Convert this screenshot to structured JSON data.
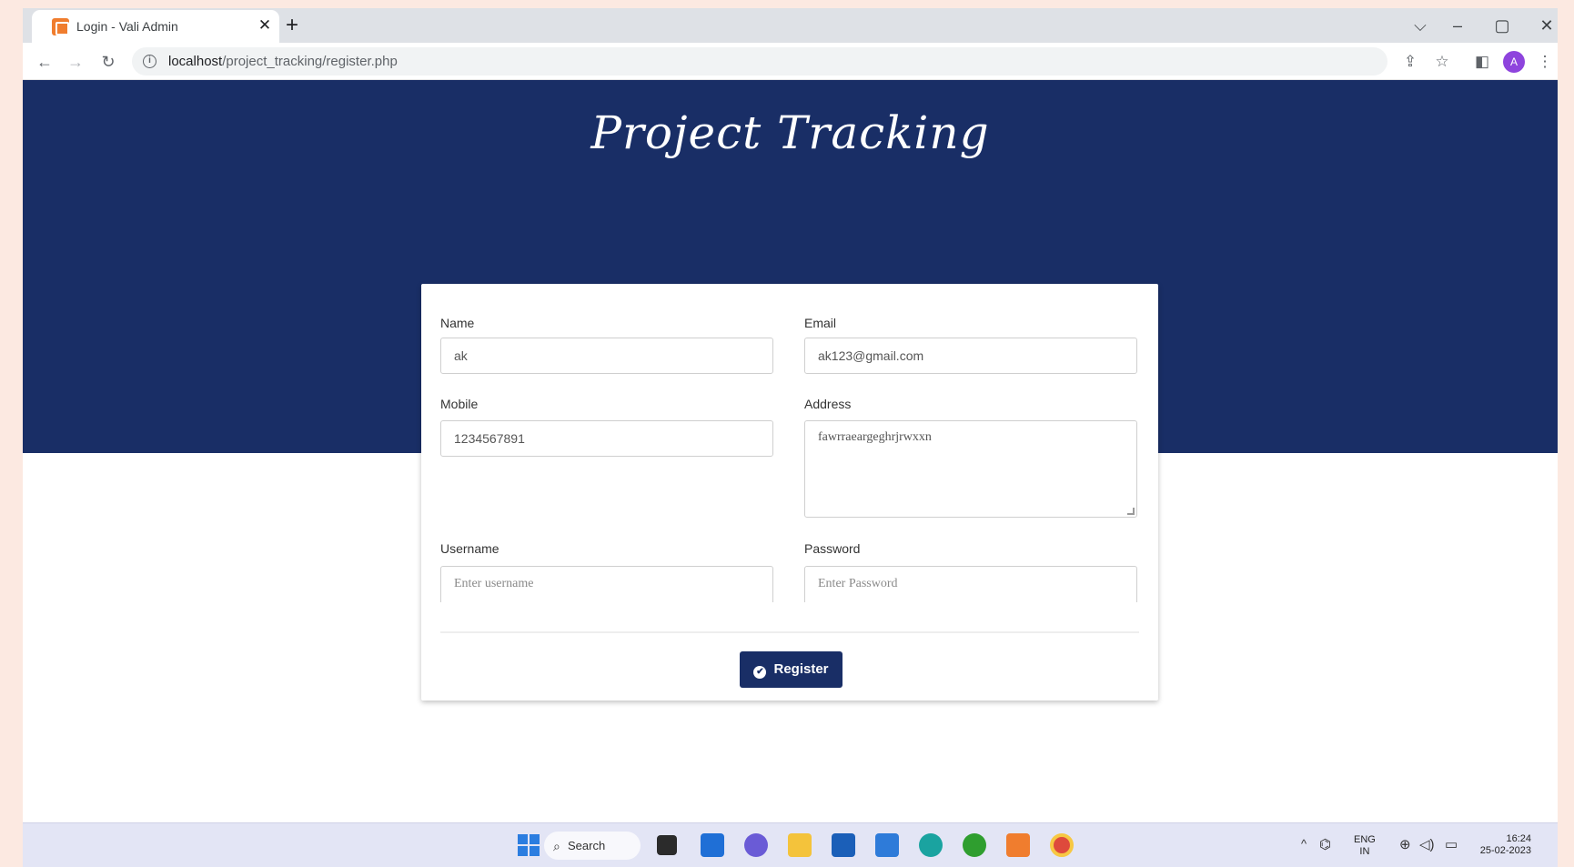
{
  "browser": {
    "tab_title": "Login - Vali Admin",
    "url_host": "localhost",
    "url_path": "/project_tracking/register.php",
    "controls": {
      "tab_list": "⌵",
      "minimize": "–",
      "maximize": "▢",
      "close": "✕",
      "tab_close": "✕",
      "new_tab": "+",
      "back": "←",
      "forward": "→",
      "reload": "↻",
      "info": "i",
      "share": "⇪",
      "bookmark": "☆",
      "sidepanel": "◧",
      "menu": "⋮"
    },
    "avatar_letter": "A"
  },
  "page": {
    "title": "Project Tracking",
    "form": {
      "name_label": "Name",
      "name_value": "ak",
      "email_label": "Email",
      "email_value": "ak123@gmail.com",
      "mobile_label": "Mobile",
      "mobile_value": "1234567891",
      "address_label": "Address",
      "address_value": "fawrraeargeghrjrwxxn",
      "username_label": "Username",
      "username_placeholder": "Enter username",
      "password_label": "Password",
      "password_placeholder": "Enter Password",
      "register_label": "Register",
      "register_icon": "✔"
    }
  },
  "taskbar": {
    "search_label": "Search",
    "search_icon": "⌕",
    "tray": {
      "chevron": "^",
      "lang_top": "ENG",
      "lang_bottom": "IN",
      "time": "16:24",
      "date": "25-02-2023",
      "network_icon": "⊕",
      "volume_icon": "◁)",
      "battery_icon": "▭"
    }
  }
}
